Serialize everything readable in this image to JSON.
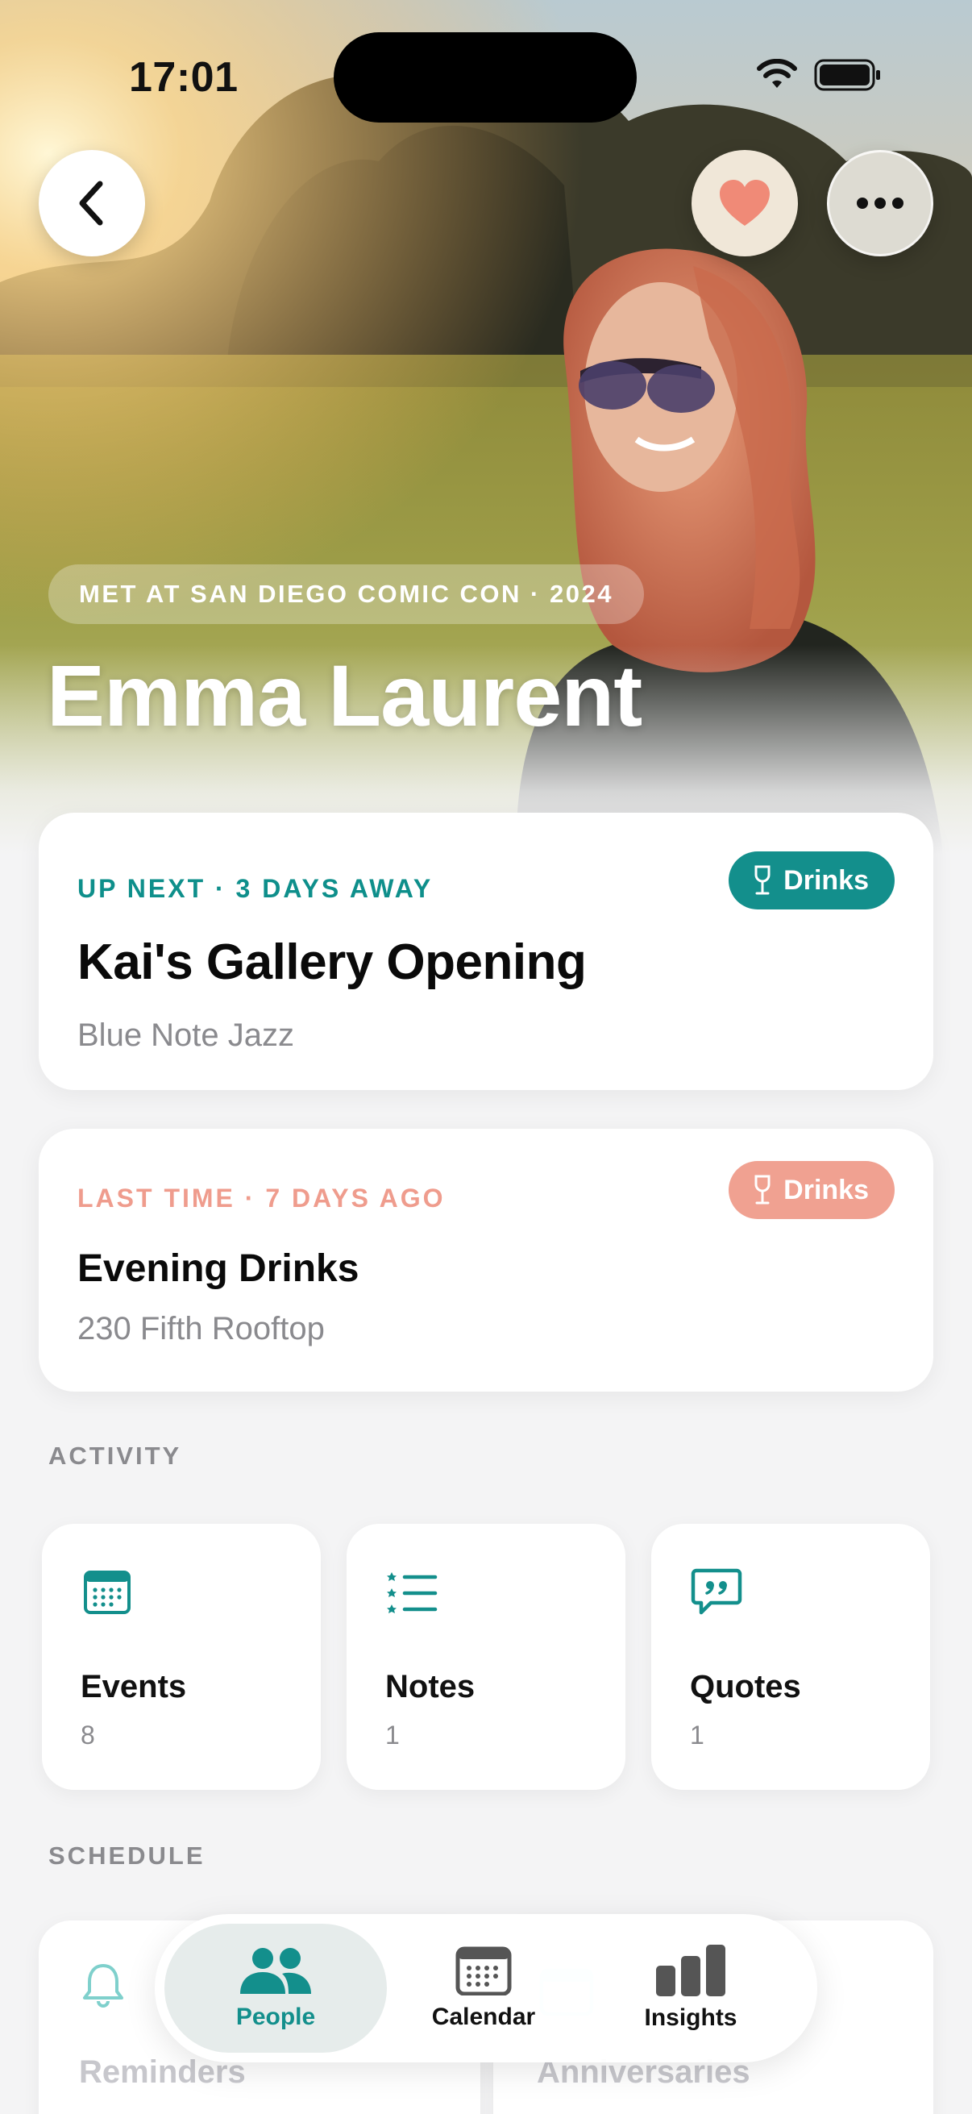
{
  "status": {
    "time": "17:01"
  },
  "hero": {
    "met_label": "MET AT SAN DIEGO COMIC CON · 2024",
    "name": "Emma Laurent"
  },
  "up_next": {
    "eyebrow": "UP NEXT · 3 DAYS AWAY",
    "tag": "Drinks",
    "title": "Kai's Gallery Opening",
    "location": "Blue Note Jazz"
  },
  "last_time": {
    "eyebrow": "LAST TIME · 7 DAYS AGO",
    "tag": "Drinks",
    "title": "Evening Drinks",
    "location": "230 Fifth Rooftop"
  },
  "activity": {
    "label": "ACTIVITY",
    "items": [
      {
        "label": "Events",
        "value": "8",
        "icon": "calendar-icon"
      },
      {
        "label": "Notes",
        "value": "1",
        "icon": "list-icon"
      },
      {
        "label": "Quotes",
        "value": "1",
        "icon": "quote-bubble-icon"
      }
    ]
  },
  "schedule": {
    "label": "SCHEDULE",
    "items": [
      {
        "label": "Reminders",
        "icon": "bell-icon"
      },
      {
        "label": "Anniversaries",
        "icon": "calendar-icon"
      }
    ]
  },
  "tabbar": {
    "items": [
      {
        "label": "People",
        "icon": "people-icon",
        "selected": true
      },
      {
        "label": "Calendar",
        "icon": "calendar-icon",
        "selected": false
      },
      {
        "label": "Insights",
        "icon": "bar-chart-icon",
        "selected": false
      }
    ]
  },
  "colors": {
    "accent": "#138f8c",
    "past": "#f0a191",
    "favorite": "#f08a77"
  }
}
